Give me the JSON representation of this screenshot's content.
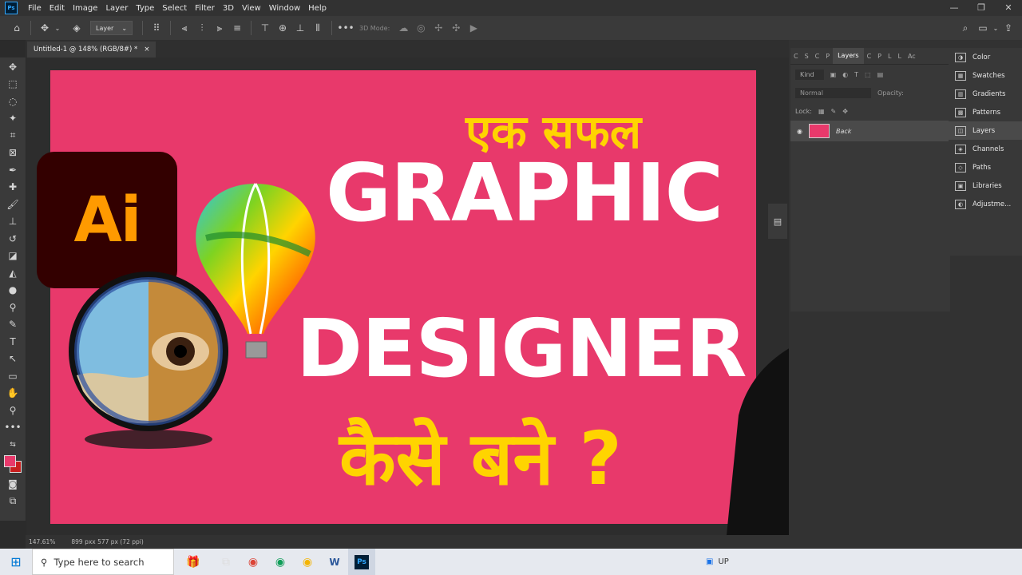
{
  "app": {
    "logo_text": "Ps"
  },
  "menu": [
    "File",
    "Edit",
    "Image",
    "Layer",
    "Type",
    "Select",
    "Filter",
    "3D",
    "View",
    "Window",
    "Help"
  ],
  "window_controls": {
    "minimize": "—",
    "restore": "❐",
    "close": "✕"
  },
  "options_bar": {
    "layer_select": "Layer",
    "mode_3d": "3D Mode:"
  },
  "document": {
    "tab_title": "Untitled-1 @ 148% (RGB/8#) *",
    "tab_close": "×"
  },
  "status": {
    "zoom": "147.61%",
    "dimensions": "899 pxx 577 px (72 ppi)"
  },
  "layers_panel": {
    "tabs": [
      "C",
      "S",
      "C",
      "P",
      "Layers",
      "C",
      "P",
      "L",
      "L",
      "Ac"
    ],
    "active_tab": "Layers",
    "kind_label": "Kind",
    "blend_mode": "Normal",
    "opacity_label": "Opacity:",
    "lock_label": "Lock:",
    "layer_name": "Back"
  },
  "side_panels": [
    "Color",
    "Swatches",
    "Gradients",
    "Patterns",
    "Layers",
    "Channels",
    "Paths",
    "Libraries",
    "Adjustme..."
  ],
  "side_icons": [
    "color-icon",
    "swatches-icon",
    "gradients-icon",
    "patterns-icon",
    "layers-icon",
    "channels-icon",
    "paths-icon",
    "libraries-icon",
    "adjustments-icon"
  ],
  "thumbnail": {
    "line1": "एक सफल",
    "line2": "GRAPHIC",
    "line3": "DESIGNER",
    "line4": "कैसे बने ?",
    "ai_logo_text": "Ai",
    "colors": {
      "background": "#e8396b",
      "yellow": "#ffd400",
      "white": "#ffffff"
    }
  },
  "taskbar": {
    "search_placeholder": "Type here to search",
    "tray_text": "UP"
  }
}
